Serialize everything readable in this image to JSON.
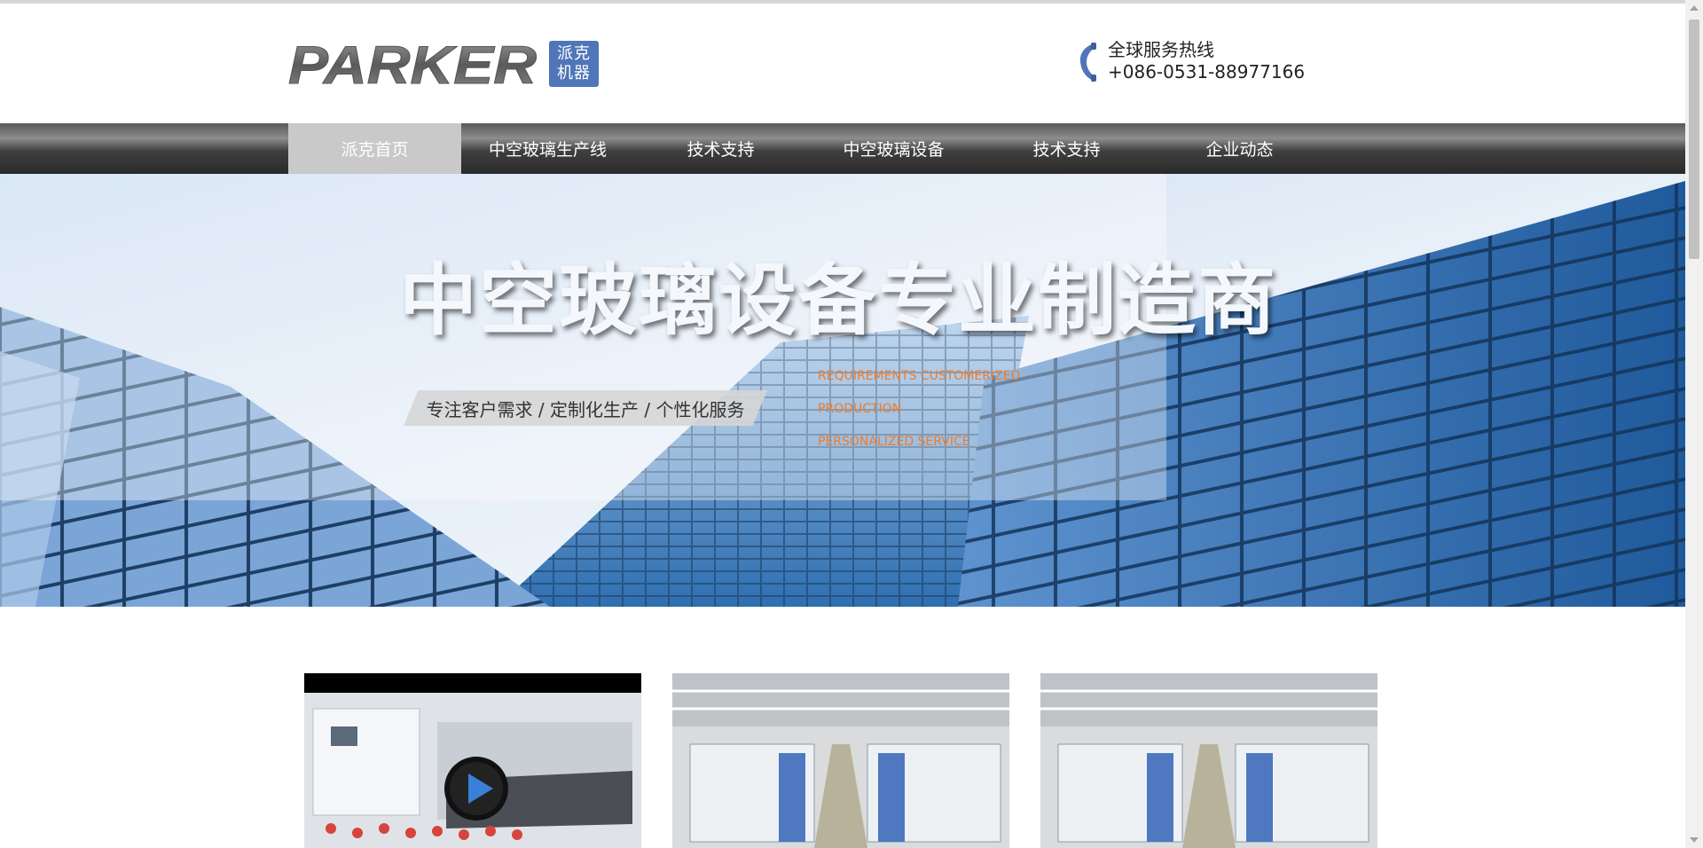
{
  "brand": {
    "logo_text": "PARKER",
    "badge_line1": "派克",
    "badge_line2": "机器",
    "badge_color": "#4f76b8"
  },
  "hotline": {
    "label": "全球服务热线",
    "number": "+086-0531-88977166",
    "icon": "phone-icon"
  },
  "nav": {
    "items": [
      {
        "label": "派克首页",
        "active": true
      },
      {
        "label": "中空玻璃生产线"
      },
      {
        "label": "技术支持"
      },
      {
        "label": "中空玻璃设备"
      },
      {
        "label": "技术支持"
      },
      {
        "label": "企业动态"
      }
    ]
  },
  "banner": {
    "title": "中空玻璃设备专业制造商",
    "slogan": "专注客户需求 / 定制化生产 / 个性化服务",
    "en_lines": [
      "REQUIREMENTS CUSTOMERIZED",
      "PRODUCTION",
      "PERSONALIZED SERVICE"
    ],
    "en_color": "#f07b2a"
  },
  "cards": [
    {
      "type": "video",
      "icon": "play-icon"
    },
    {
      "type": "image"
    },
    {
      "type": "image"
    }
  ],
  "colors": {
    "nav_active_bg": "#c9c9c9",
    "nav_bg": "#3f3f3f"
  }
}
